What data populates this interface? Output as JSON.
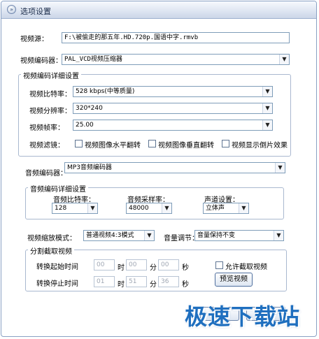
{
  "window": {
    "title": "选项设置"
  },
  "video": {
    "source_label": "视频源：",
    "source_value": "F:\\被偷走的那五年.HD.720p.国语中字.rmvb",
    "encoder_label": "视频编码器：",
    "encoder_value": "PAL_VCD视频压缩器",
    "detail_group": "视频编码详细设置",
    "bitrate_label": "视频比特率：",
    "bitrate_value": "528 kbps(中等质量)",
    "resolution_label": "视频分辨率：",
    "resolution_value": "320*240",
    "framerate_label": "视频帧率：",
    "framerate_value": "25.00",
    "filter_label": "视频滤镜：",
    "filter_hflip": "视频图像水平翻转",
    "filter_vflip": "视频图像垂直翻转",
    "filter_reverse": "视频显示倒片效果"
  },
  "audio": {
    "encoder_label": "音频编码器：",
    "encoder_value": "MP3音频编码器",
    "detail_group": "音频编码详细设置",
    "bitrate_label": "音频比特率：",
    "bitrate_value": "128",
    "samplerate_label": "音频采样率：",
    "samplerate_value": "48000",
    "channel_label": "声道设置：",
    "channel_value": "立体声"
  },
  "scaling": {
    "label": "视频缩放模式：",
    "value": "普通视频4:3模式",
    "volume_label": "音量调节：",
    "volume_value": "音量保持不变"
  },
  "clip": {
    "group": "分割截取视频",
    "start_label": "转换起始时间",
    "stop_label": "转换停止时间",
    "hour_unit": "时",
    "minute_unit": "分",
    "second_unit": "秒",
    "start_h": "00",
    "start_m": "00",
    "start_s": "00",
    "stop_h": "01",
    "stop_m": "51",
    "stop_s": "36",
    "allow_label": "允许截取视频",
    "preview_button": "预览视频"
  },
  "watermark": {
    "text": "极速下载站"
  },
  "footer": {
    "ok_button_partial": "确",
    "cancel_button_partial": "取"
  }
}
